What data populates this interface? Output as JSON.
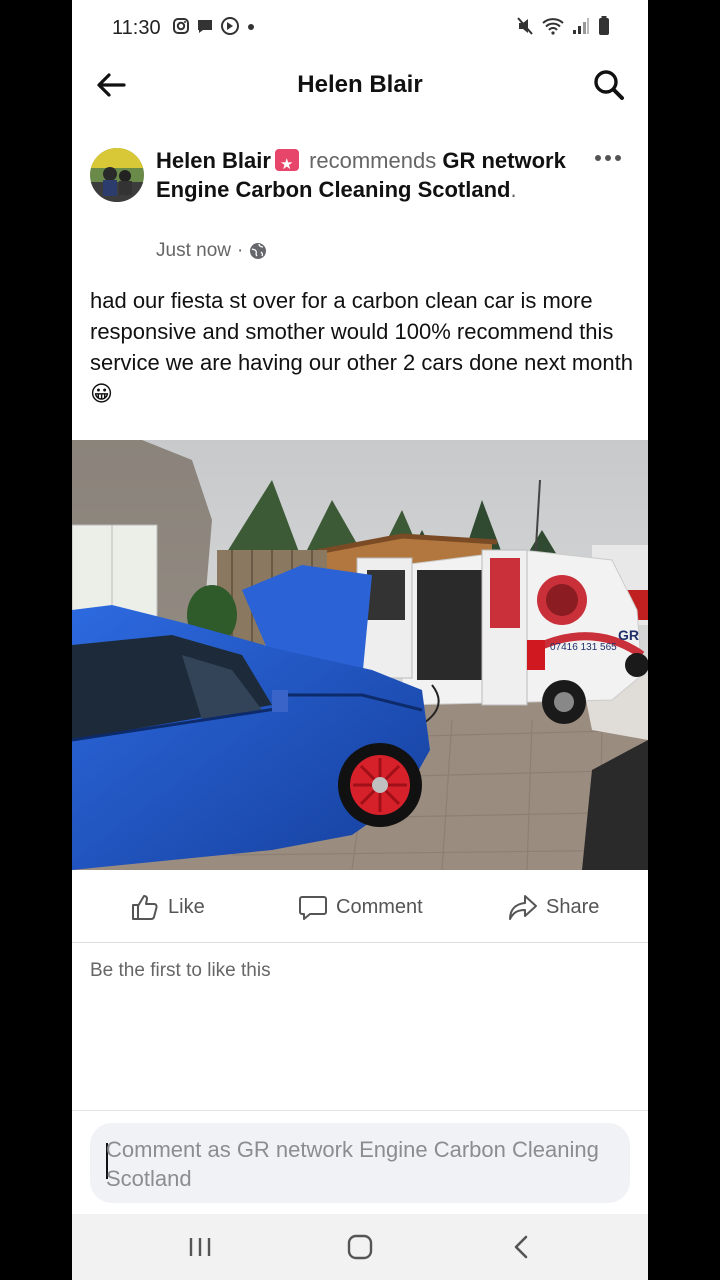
{
  "status_bar": {
    "time": "11:30",
    "left_icons": [
      "instagram-icon",
      "messenger-icon",
      "vpn-icon",
      "dot-icon"
    ],
    "right_icons": [
      "mute-icon",
      "wifi-icon",
      "signal-icon",
      "battery-icon"
    ]
  },
  "header": {
    "title": "Helen Blair",
    "back_icon": "arrow-left-icon",
    "search_icon": "search-icon"
  },
  "post": {
    "author": "Helen Blair",
    "recommends_text": "recommends",
    "page_name": "GR network Engine Carbon Cleaning Scotland",
    "period": ".",
    "timestamp": "Just now",
    "separator": "·",
    "privacy_icon": "globe-icon",
    "text": "had our fiesta st over for a carbon clean car is more responsive and smother would 100% recommend this service we are having our other 2 cars done next month 😀"
  },
  "actions": {
    "like": "Like",
    "comment": "Comment",
    "share": "Share"
  },
  "reactions_summary": "Be the first to like this",
  "comment_box": {
    "placeholder": "Comment as GR network Engine Carbon Cleaning Scotland"
  },
  "van_text": {
    "phone": "07416 131 565",
    "brand": "GR"
  },
  "colors": {
    "car_blue": "#1f57c8",
    "wheel_red": "#d6202a",
    "badge": "#e8456b"
  },
  "nav_bar": [
    "recents-icon",
    "home-icon",
    "back-icon"
  ]
}
